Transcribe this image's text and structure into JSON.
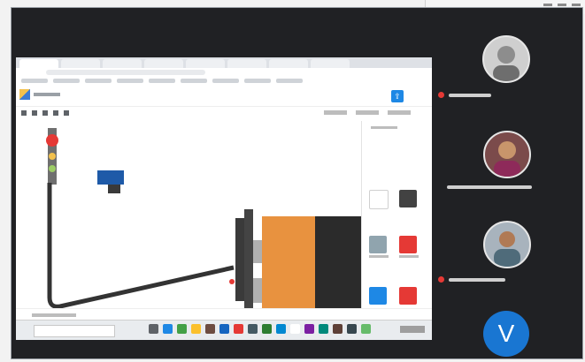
{
  "toolbar": {
    "share_icon_label": "⇪"
  },
  "participants": {
    "avatar_letter": "V"
  },
  "colors": {
    "battery_orange": "#e8923f",
    "battery_dark": "#2b2b2b",
    "wire": "#333333",
    "mic_off": "#e53935",
    "avatar_blue": "#1976d2"
  }
}
